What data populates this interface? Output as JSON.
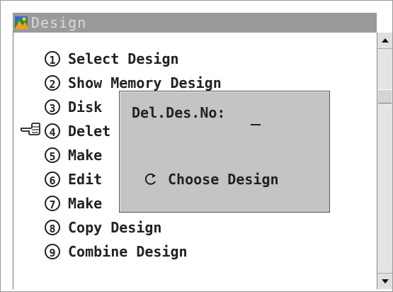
{
  "window": {
    "title": "Design"
  },
  "menu": [
    {
      "num": "1",
      "label": "Select Design"
    },
    {
      "num": "2",
      "label": "Show Memory Design"
    },
    {
      "num": "3",
      "label": "Disk"
    },
    {
      "num": "4",
      "label": "Delet"
    },
    {
      "num": "5",
      "label": "Make"
    },
    {
      "num": "6",
      "label": "Edit"
    },
    {
      "num": "7",
      "label": "Make"
    },
    {
      "num": "8",
      "label": "Copy Design"
    },
    {
      "num": "9",
      "label": "Combine Design"
    }
  ],
  "dialog": {
    "label": "Del.Des.No:",
    "input_value": "",
    "choose_label": "Choose Design"
  },
  "icons": {
    "title": "design-app-icon",
    "pointer": "pointing-hand-icon",
    "choose": "cycle-arrow-icon",
    "scroll_up": "scroll-up-arrow-icon",
    "scroll_down": "scroll-down-arrow-icon"
  }
}
